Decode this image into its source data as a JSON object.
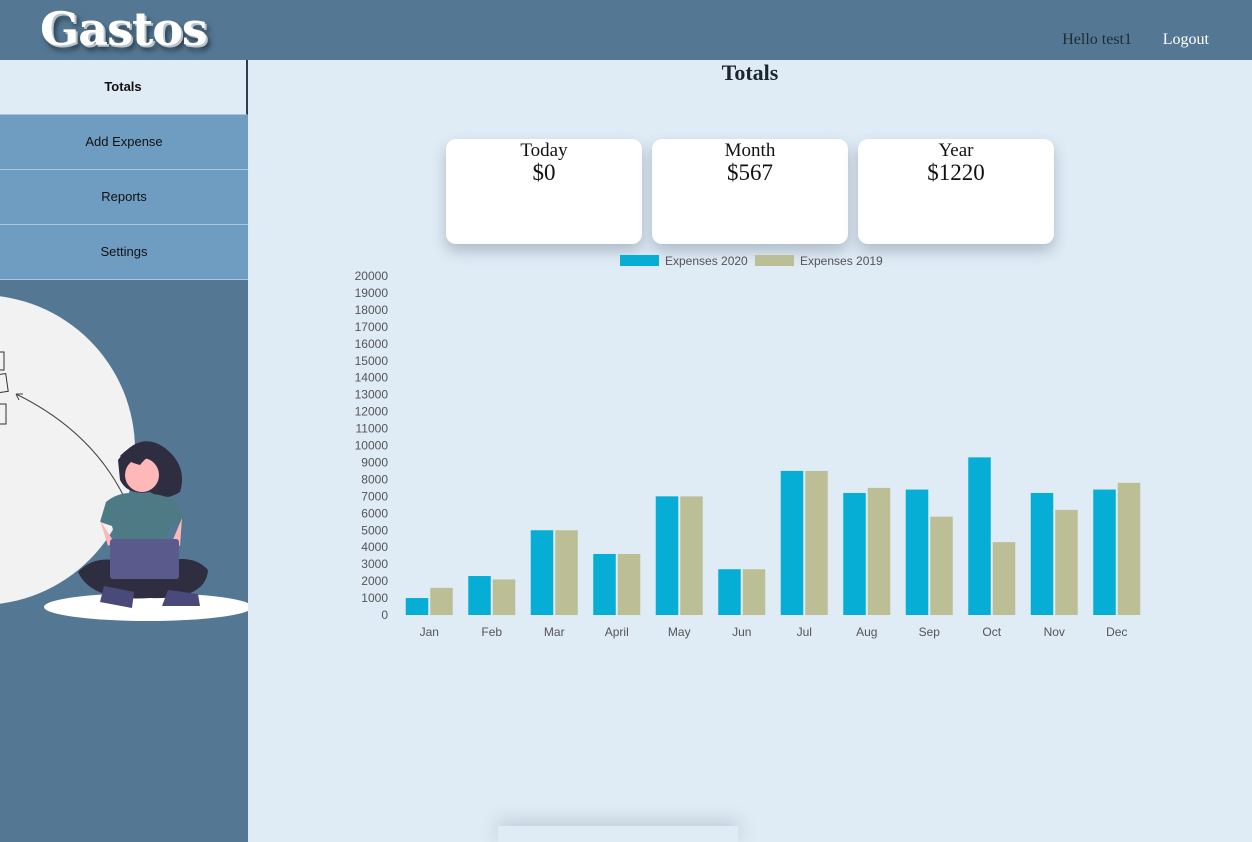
{
  "header": {
    "logo": "Gastos",
    "greeting": "Hello test1",
    "logout_label": "Logout"
  },
  "sidebar": {
    "items": [
      {
        "label": "Totals",
        "active": true
      },
      {
        "label": "Add Expense",
        "active": false
      },
      {
        "label": "Reports",
        "active": false
      },
      {
        "label": "Settings",
        "active": false
      }
    ]
  },
  "main": {
    "title": "Totals",
    "cards": [
      {
        "label": "Today",
        "value": "$0"
      },
      {
        "label": "Month",
        "value": "$567"
      },
      {
        "label": "Year",
        "value": "$1220"
      }
    ]
  },
  "colors": {
    "header_bg": "#547894",
    "sidebar_item": "#6f9dc1",
    "page_bg": "#dfebf5",
    "series_2020": "#06aed5",
    "series_2019": "#bcbf96"
  },
  "chart_data": {
    "type": "bar",
    "categories": [
      "Jan",
      "Feb",
      "Mar",
      "April",
      "May",
      "Jun",
      "Jul",
      "Aug",
      "Sep",
      "Oct",
      "Nov",
      "Dec"
    ],
    "series": [
      {
        "name": "Expenses 2020",
        "color": "#06aed5",
        "values": [
          1000,
          2300,
          5000,
          3600,
          7000,
          2700,
          8500,
          7200,
          7400,
          9300,
          7200,
          7400
        ]
      },
      {
        "name": "Expenses 2019",
        "color": "#bcbf96",
        "values": [
          1600,
          2100,
          5000,
          3600,
          7000,
          2700,
          8500,
          7500,
          5800,
          4300,
          6200,
          7800
        ]
      }
    ],
    "ylim": [
      0,
      20000
    ],
    "yticks": [
      0,
      1000,
      2000,
      3000,
      4000,
      5000,
      6000,
      7000,
      8000,
      9000,
      10000,
      11000,
      12000,
      13000,
      14000,
      15000,
      16000,
      17000,
      18000,
      19000,
      20000
    ],
    "legend": "top-center",
    "grid": false
  }
}
